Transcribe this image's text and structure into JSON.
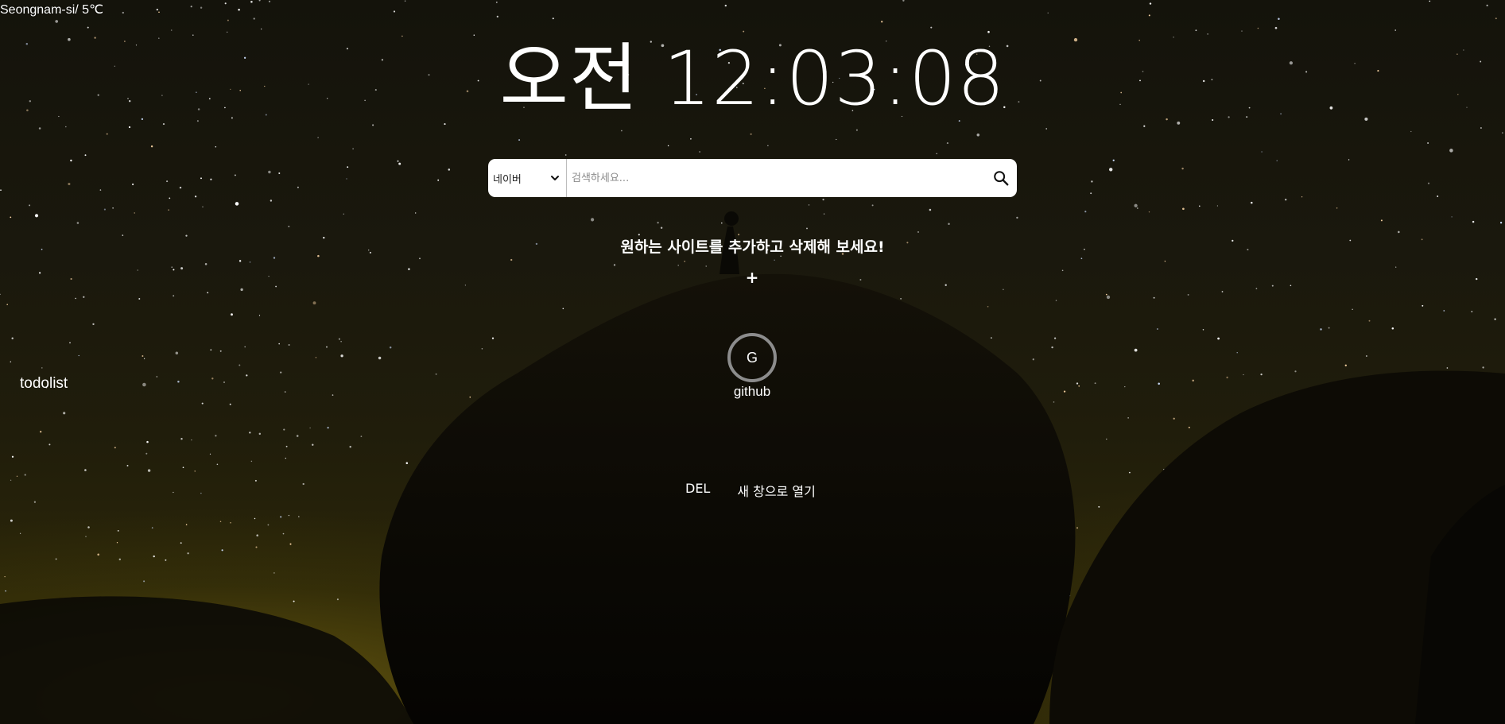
{
  "weather": {
    "text": "Seongnam-si/ 5℃"
  },
  "clock": {
    "text": "오전 12:03:08"
  },
  "search": {
    "engine_selected": "네이버",
    "placeholder": "검색하세요...",
    "value": ""
  },
  "shortcuts": {
    "headline": "원하는 사이트를 추가하고 삭제해 보세요!",
    "add_label": "+",
    "items": [
      {
        "initial": "G",
        "label": "github"
      }
    ],
    "delete_label": "DEL",
    "open_new_window_label": "새 창으로 열기"
  },
  "todolist": {
    "label": "todolist"
  },
  "colors": {
    "text": "#ffffff",
    "search_bg": "#ffffff",
    "shortcut_ring": "#8c8c8c"
  }
}
